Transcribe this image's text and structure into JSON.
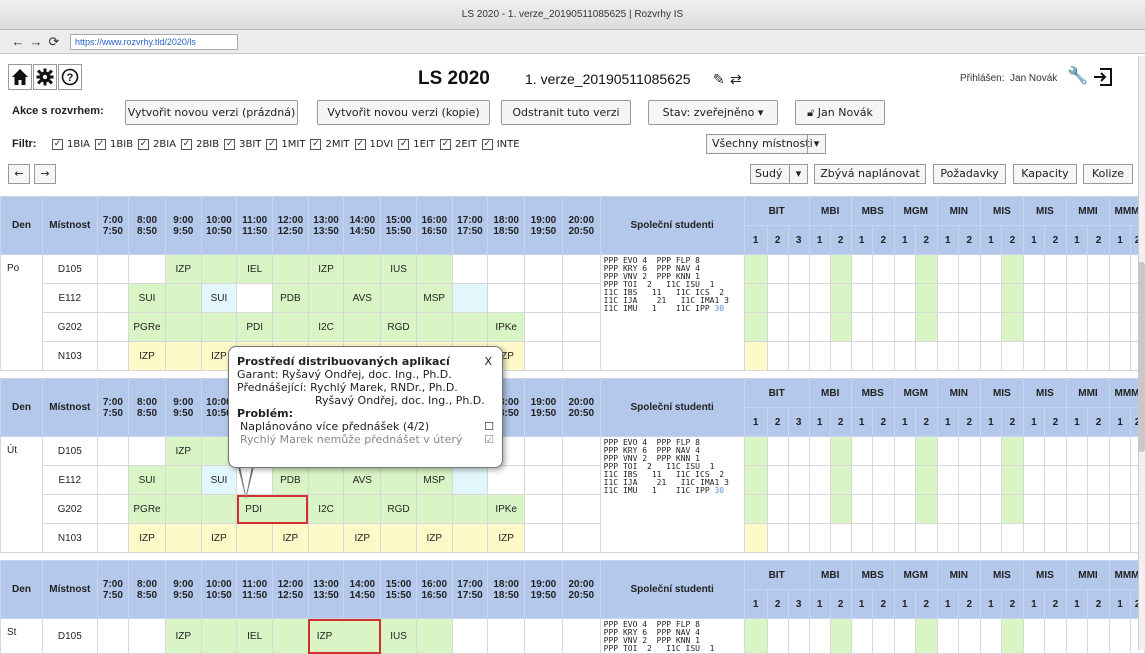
{
  "window": {
    "title": "LS 2020 - 1. verze_20190511085625 | Rozvrhy IS"
  },
  "browser": {
    "url": "https://www.rozvrhy.tld/2020/ls",
    "back": "←",
    "forward": "→",
    "reload": "⟳"
  },
  "header": {
    "term": "LS 2020",
    "version": "1. verze_20190511085625",
    "login_label": "Přihlášen:",
    "user": "Jan Novák"
  },
  "actions": {
    "label": "Akce s rozvrhem:",
    "new_empty": "Vytvořit novou verzi (prázdná)",
    "new_copy": "Vytvořit novou verzi (kopie)",
    "delete": "Odstranit tuto verzi",
    "state": "Stav: zveřejněno",
    "owner": "Jan Novák"
  },
  "filter": {
    "label": "Filtr:",
    "items": [
      "1BIA",
      "1BIB",
      "2BIA",
      "2BIB",
      "3BIT",
      "1MIT",
      "2MIT",
      "1DVI",
      "1EIT",
      "2EIT",
      "INTE"
    ],
    "rooms": "Všechny místnosti"
  },
  "toolbar": {
    "week": "Sudý",
    "remaining": "Zbývá naplánovat",
    "requests": "Požadavky",
    "capacity": "Kapacity",
    "collisions": "Kolize"
  },
  "grid": {
    "col_day": "Den",
    "col_room": "Místnost",
    "col_students": "Společní studenti",
    "times": [
      [
        "7:00",
        "7:50"
      ],
      [
        "8:00",
        "8:50"
      ],
      [
        "9:00",
        "9:50"
      ],
      [
        "10:00",
        "10:50"
      ],
      [
        "11:00",
        "11:50"
      ],
      [
        "12:00",
        "12:50"
      ],
      [
        "13:00",
        "13:50"
      ],
      [
        "14:00",
        "14:50"
      ],
      [
        "15:00",
        "15:50"
      ],
      [
        "16:00",
        "16:50"
      ],
      [
        "17:00",
        "17:50"
      ],
      [
        "18:00",
        "18:50"
      ],
      [
        "19:00",
        "19:50"
      ],
      [
        "20:00",
        "20:50"
      ]
    ],
    "programs": [
      "BIT",
      "MBI",
      "MBS",
      "MGM",
      "MIN",
      "MIS",
      "MIS",
      "MMI",
      "MMM"
    ],
    "years": [
      "1",
      "2",
      "3",
      "1",
      "2",
      "1",
      "2",
      "1",
      "2",
      "1",
      "2",
      "1",
      "2",
      "1",
      "2",
      "1",
      "2",
      "1",
      "2"
    ],
    "days": [
      {
        "name": "Po",
        "rooms": [
          "D105",
          "E112",
          "G202",
          "N103"
        ],
        "students": "PPP EVO 4  PPP FLP 8\nPPP KRY 6  PPP NAV 4\nPPP VNV 2  PPP KNN 1\nPPP TOI  2   I1C ISU  1\nI1C IBS   11   I1C ICS  2\nI1C IJA    21   I1C IMA1 3\nI1C IMU   1    I1C IPP",
        "students_extra": "30"
      },
      {
        "name": "Út",
        "rooms": [
          "D105",
          "E112",
          "G202",
          "N103"
        ],
        "students": "PPP EVO 4  PPP FLP 8\nPPP KRY 6  PPP NAV 4\nPPP VNV 2  PPP KNN 1\nPPP TOI  2   I1C ISU  1\nI1C IBS   11   I1C ICS  2\nI1C IJA    21   I1C IMA1 3\nI1C IMU   1    I1C IPP",
        "students_extra": "30"
      },
      {
        "name": "St",
        "rooms": [
          "D105"
        ],
        "students": "PPP EVO 4  PPP FLP 8\nPPP KRY 6  PPP NAV 4\nPPP VNV 2  PPP KNN 1\nPPP TOI  2   I1C ISU  1",
        "students_extra": ""
      }
    ],
    "cells": {
      "IZP": "IZP",
      "IEL": "IEL",
      "IUS": "IUS",
      "SUI": "SUI",
      "PDB": "PDB",
      "AVS": "AVS",
      "MSP": "MSP",
      "PGRe": "PGRe",
      "PDI": "PDI",
      "I2C": "I2C",
      "RGD": "RGD",
      "IPKe": "IPKe"
    }
  },
  "popup": {
    "title": "Prostředí distribuovaných aplikací",
    "close": "X",
    "garant": "Garant: Ryšavý Ondřej, doc. Ing., Ph.D.",
    "lecturers_label": "Přednášející: Rychlý Marek, RNDr., Ph.D.",
    "lecturer2": "Ryšavý Ondřej, doc. Ing., Ph.D.",
    "problem_label": "Problém:",
    "problem1": "Naplánováno více přednášek (4/2)",
    "problem2": "Rychlý Marek nemůže přednášet v úterý"
  },
  "colors": {
    "header_blue": "#b3c8eb",
    "green": "#d9f5c5",
    "yellow": "#fdf9c8",
    "cyan": "#e2f7fb",
    "selection": "#d03030"
  }
}
